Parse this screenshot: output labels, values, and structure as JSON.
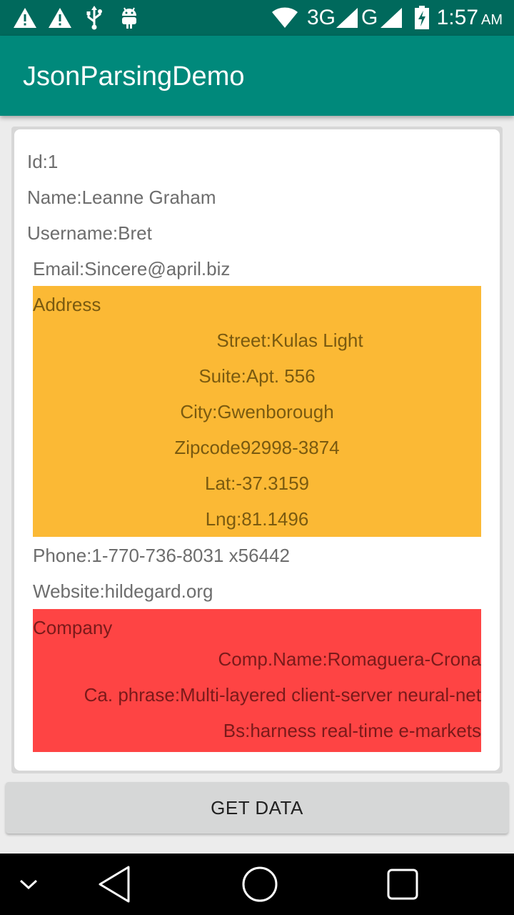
{
  "status_bar": {
    "icons": [
      "warning-icon",
      "warning-icon",
      "usb-icon",
      "android-debug-icon",
      "wifi-icon",
      "signal-icon",
      "signal-icon",
      "battery-icon"
    ],
    "network_3g": "3G",
    "network_g": "G",
    "time": "1:57",
    "ampm": "AM"
  },
  "app_bar": {
    "title": "JsonParsingDemo"
  },
  "user": {
    "id": "Id:1",
    "name": "Name:Leanne Graham",
    "username": "Username:Bret",
    "email": "Email:Sincere@april.biz",
    "phone": "Phone:1-770-736-8031 x56442",
    "website": "Website:hildegard.org"
  },
  "address": {
    "header": "Address",
    "street": "Street:Kulas Light",
    "suite": "Suite:Apt. 556",
    "city": "City:Gwenborough",
    "zipcode": "Zipcode92998-3874",
    "lat": "Lat:-37.3159",
    "lng": "Lng:81.1496"
  },
  "company": {
    "header": "Company",
    "name": "Comp.Name:Romaguera-Crona",
    "catch_phrase": "Ca. phrase:Multi-layered client-server neural-net",
    "bs": "Bs:harness real-time e-markets"
  },
  "button": {
    "label": "GET DATA"
  },
  "colors": {
    "status_bar": "#00695c",
    "app_bar": "#00897b",
    "address_bg": "#fbb935",
    "company_bg": "#fe4444"
  },
  "nav_bar": {
    "icons": [
      "chevron-down-icon",
      "back-icon",
      "home-icon",
      "recents-icon"
    ]
  }
}
